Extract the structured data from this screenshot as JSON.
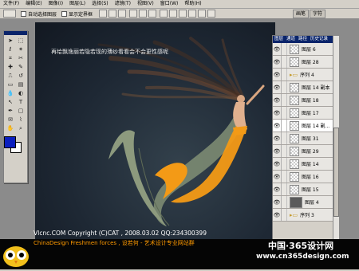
{
  "menubar": {
    "items": [
      "文件(F)",
      "编辑(E)",
      "图像(I)",
      "图层(L)",
      "选择(S)",
      "滤镜(T)",
      "视图(V)",
      "窗口(W)",
      "帮助(H)"
    ]
  },
  "options": {
    "auto_select": "自动选择图层",
    "show_bounds": "显示定界框"
  },
  "right_tabs": [
    "画笔",
    "字符"
  ],
  "canvas": {
    "caption": "再给飘逸丽若隐若现的薄纱看看会不会更性感呢"
  },
  "colors": {
    "foreground": "#0b1fbf",
    "background": "#ffffff",
    "accent_orange": "#f39a16"
  },
  "tools": [
    "move-icon",
    "marquee-icon",
    "lasso-icon",
    "magic-wand-icon",
    "crop-icon",
    "slice-icon",
    "healing-icon",
    "brush-icon",
    "stamp-icon",
    "history-brush-icon",
    "eraser-icon",
    "gradient-icon",
    "blur-icon",
    "dodge-icon",
    "path-select-icon",
    "type-icon",
    "pen-icon",
    "shape-icon",
    "notes-icon",
    "eyedropper-icon",
    "hand-icon",
    "zoom-icon"
  ],
  "layers_panel": {
    "tabs": [
      "图层",
      "通道",
      "路径",
      "历史记录"
    ],
    "layers": [
      {
        "name": "图层 6",
        "type": "layer"
      },
      {
        "name": "图层 28",
        "type": "layer"
      },
      {
        "name": "序列 4",
        "type": "group"
      },
      {
        "name": "图层 14 副本",
        "type": "layer"
      },
      {
        "name": "图层 18",
        "type": "layer"
      },
      {
        "name": "图层 17",
        "type": "layer"
      },
      {
        "name": "图层 14 副...",
        "type": "layer"
      },
      {
        "name": "图层 31",
        "type": "layer"
      },
      {
        "name": "图层 29",
        "type": "layer"
      },
      {
        "name": "图层 14",
        "type": "layer"
      },
      {
        "name": "图层 16",
        "type": "layer"
      },
      {
        "name": "图层 15",
        "type": "layer"
      },
      {
        "name": "图层 4",
        "type": "layer"
      },
      {
        "name": "序列 3",
        "type": "group"
      }
    ]
  },
  "footer": {
    "line1": "VIcnc.COM    Copyright (C)CAT , 2008.03.02    QQ:234300399",
    "line2": "ChinaDesign Freshmen forces , 设若何 - 艺术设计专业网站群",
    "watermark_cn": "中国·365设计网",
    "watermark_url": "www.cn365design.com"
  }
}
